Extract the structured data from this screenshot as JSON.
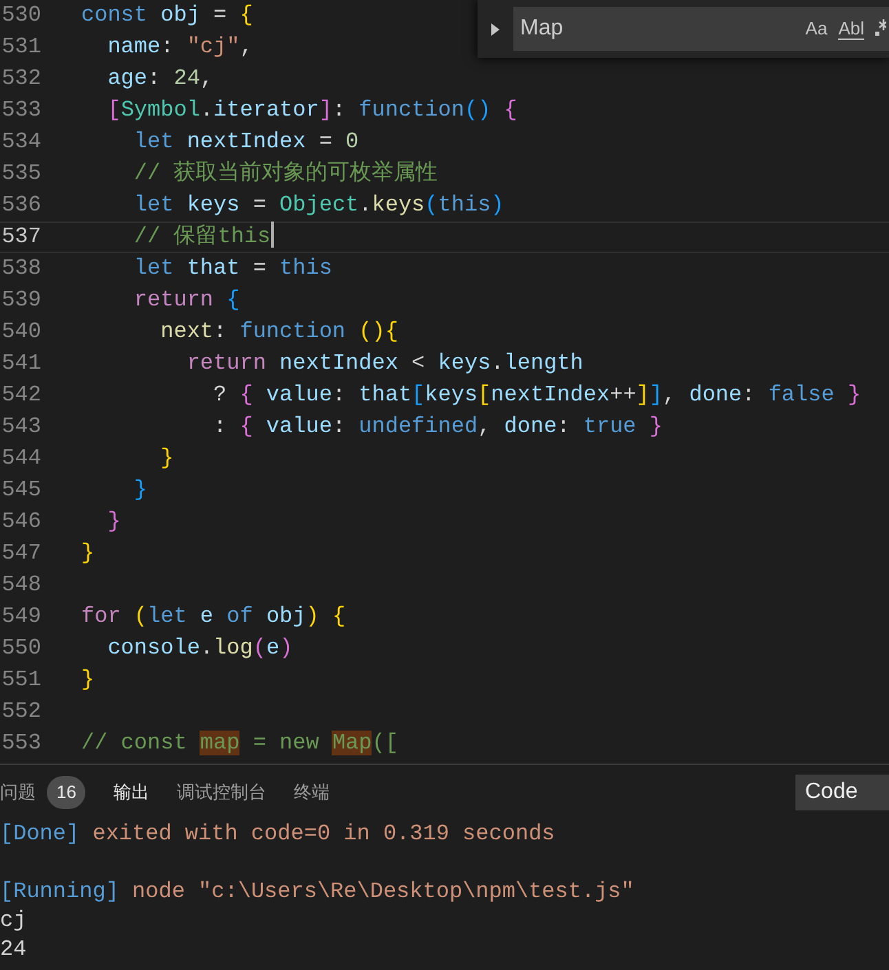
{
  "editor": {
    "lines": [
      {
        "number": "530",
        "current": false,
        "tokens": [
          {
            "kind": "kw",
            "text": "const "
          },
          {
            "kind": "var",
            "text": "obj"
          },
          {
            "kind": "punct",
            "text": " = "
          },
          {
            "kind": "b1",
            "text": "{"
          }
        ]
      },
      {
        "number": "531",
        "current": false,
        "tokens": [
          {
            "kind": "var",
            "text": "  name"
          },
          {
            "kind": "punct",
            "text": ": "
          },
          {
            "kind": "str",
            "text": "\"cj\""
          },
          {
            "kind": "punct",
            "text": ","
          }
        ]
      },
      {
        "number": "532",
        "current": false,
        "tokens": [
          {
            "kind": "var",
            "text": "  age"
          },
          {
            "kind": "punct",
            "text": ": "
          },
          {
            "kind": "num",
            "text": "24"
          },
          {
            "kind": "punct",
            "text": ","
          }
        ]
      },
      {
        "number": "533",
        "current": false,
        "tokens": [
          {
            "kind": "b2",
            "text": "  ["
          },
          {
            "kind": "cls",
            "text": "Symbol"
          },
          {
            "kind": "punct",
            "text": "."
          },
          {
            "kind": "var",
            "text": "iterator"
          },
          {
            "kind": "b2",
            "text": "]"
          },
          {
            "kind": "punct",
            "text": ": "
          },
          {
            "kind": "kw",
            "text": "function"
          },
          {
            "kind": "b3",
            "text": "()"
          },
          {
            "kind": "b2",
            "text": " {"
          }
        ]
      },
      {
        "number": "534",
        "current": false,
        "tokens": [
          {
            "kind": "kw",
            "text": "    let "
          },
          {
            "kind": "var",
            "text": "nextIndex"
          },
          {
            "kind": "punct",
            "text": " = "
          },
          {
            "kind": "num",
            "text": "0"
          }
        ]
      },
      {
        "number": "535",
        "current": false,
        "tokens": [
          {
            "kind": "comment",
            "text": "    // 获取当前对象的可枚举属性"
          }
        ]
      },
      {
        "number": "536",
        "current": false,
        "tokens": [
          {
            "kind": "kw",
            "text": "    let "
          },
          {
            "kind": "var",
            "text": "keys"
          },
          {
            "kind": "punct",
            "text": " = "
          },
          {
            "kind": "cls",
            "text": "Object"
          },
          {
            "kind": "punct",
            "text": "."
          },
          {
            "kind": "fn",
            "text": "keys"
          },
          {
            "kind": "b3",
            "text": "("
          },
          {
            "kind": "kw",
            "text": "this"
          },
          {
            "kind": "b3",
            "text": ")"
          }
        ]
      },
      {
        "number": "537",
        "current": true,
        "tokens": [
          {
            "kind": "comment",
            "text": "    // 保留this"
          }
        ]
      },
      {
        "number": "538",
        "current": false,
        "tokens": [
          {
            "kind": "kw",
            "text": "    let "
          },
          {
            "kind": "var",
            "text": "that"
          },
          {
            "kind": "punct",
            "text": " = "
          },
          {
            "kind": "kw",
            "text": "this"
          }
        ]
      },
      {
        "number": "539",
        "current": false,
        "tokens": [
          {
            "kind": "ctrl",
            "text": "    return "
          },
          {
            "kind": "b3",
            "text": "{"
          }
        ]
      },
      {
        "number": "540",
        "current": false,
        "tokens": [
          {
            "kind": "fn",
            "text": "      next"
          },
          {
            "kind": "punct",
            "text": ": "
          },
          {
            "kind": "kw",
            "text": "function "
          },
          {
            "kind": "b1",
            "text": "(){"
          }
        ]
      },
      {
        "number": "541",
        "current": false,
        "tokens": [
          {
            "kind": "ctrl",
            "text": "        return "
          },
          {
            "kind": "var",
            "text": "nextIndex"
          },
          {
            "kind": "punct",
            "text": " < "
          },
          {
            "kind": "var",
            "text": "keys"
          },
          {
            "kind": "punct",
            "text": "."
          },
          {
            "kind": "var",
            "text": "length"
          }
        ]
      },
      {
        "number": "542",
        "current": false,
        "tokens": [
          {
            "kind": "punct",
            "text": "          ? "
          },
          {
            "kind": "b2",
            "text": "{"
          },
          {
            "kind": "var",
            "text": " value"
          },
          {
            "kind": "punct",
            "text": ": "
          },
          {
            "kind": "var",
            "text": "that"
          },
          {
            "kind": "b3",
            "text": "["
          },
          {
            "kind": "var",
            "text": "keys"
          },
          {
            "kind": "b1",
            "text": "["
          },
          {
            "kind": "var",
            "text": "nextIndex"
          },
          {
            "kind": "punct",
            "text": "++"
          },
          {
            "kind": "b1",
            "text": "]"
          },
          {
            "kind": "b3",
            "text": "]"
          },
          {
            "kind": "punct",
            "text": ", "
          },
          {
            "kind": "var",
            "text": "done"
          },
          {
            "kind": "punct",
            "text": ": "
          },
          {
            "kind": "kw",
            "text": "false"
          },
          {
            "kind": "b2",
            "text": " }"
          }
        ]
      },
      {
        "number": "543",
        "current": false,
        "tokens": [
          {
            "kind": "punct",
            "text": "          : "
          },
          {
            "kind": "b2",
            "text": "{"
          },
          {
            "kind": "var",
            "text": " value"
          },
          {
            "kind": "punct",
            "text": ": "
          },
          {
            "kind": "kw",
            "text": "undefined"
          },
          {
            "kind": "punct",
            "text": ", "
          },
          {
            "kind": "var",
            "text": "done"
          },
          {
            "kind": "punct",
            "text": ": "
          },
          {
            "kind": "kw",
            "text": "true"
          },
          {
            "kind": "b2",
            "text": " }"
          }
        ]
      },
      {
        "number": "544",
        "current": false,
        "tokens": [
          {
            "kind": "b1",
            "text": "      }"
          }
        ]
      },
      {
        "number": "545",
        "current": false,
        "tokens": [
          {
            "kind": "b3",
            "text": "    }"
          }
        ]
      },
      {
        "number": "546",
        "current": false,
        "tokens": [
          {
            "kind": "b2",
            "text": "  }"
          }
        ]
      },
      {
        "number": "547",
        "current": false,
        "tokens": [
          {
            "kind": "b1",
            "text": "}"
          }
        ]
      },
      {
        "number": "548",
        "current": false
      },
      {
        "number": "549",
        "current": false,
        "tokens": [
          {
            "kind": "ctrl",
            "text": "for "
          },
          {
            "kind": "b1",
            "text": "("
          },
          {
            "kind": "kw",
            "text": "let "
          },
          {
            "kind": "var",
            "text": "e"
          },
          {
            "kind": "kw",
            "text": " of "
          },
          {
            "kind": "var",
            "text": "obj"
          },
          {
            "kind": "b1",
            "text": ")"
          },
          {
            "kind": "b1",
            "text": " {"
          }
        ]
      },
      {
        "number": "550",
        "current": false,
        "tokens": [
          {
            "kind": "var",
            "text": "  console"
          },
          {
            "kind": "punct",
            "text": "."
          },
          {
            "kind": "fn",
            "text": "log"
          },
          {
            "kind": "b2",
            "text": "("
          },
          {
            "kind": "var",
            "text": "e"
          },
          {
            "kind": "b2",
            "text": ")"
          }
        ]
      },
      {
        "number": "551",
        "current": false,
        "tokens": [
          {
            "kind": "b1",
            "text": "}"
          }
        ]
      },
      {
        "number": "552",
        "current": false
      },
      {
        "number": "553",
        "current": false,
        "tokens": [
          {
            "kind": "comment",
            "text": "// const "
          },
          {
            "kind": "match",
            "text": "map"
          },
          {
            "kind": "comment",
            "text": " = new "
          },
          {
            "kind": "match",
            "text": "Map"
          },
          {
            "kind": "comment",
            "text": "(["
          }
        ]
      }
    ]
  },
  "find_widget": {
    "expanded": false,
    "query": "Map",
    "match_case": "Aa",
    "whole_word": "Abl"
  },
  "panel": {
    "tabs": [
      {
        "label": "问题",
        "badge": "16",
        "selected": false
      },
      {
        "label": "输出",
        "selected": true
      },
      {
        "label": "调试控制台",
        "selected": false
      },
      {
        "label": "终端",
        "selected": false
      }
    ],
    "channel": "Code",
    "output": [
      {
        "lines": [
          [
            {
              "kind": "tag",
              "text": "[Done]"
            },
            {
              "kind": "path",
              "text": " exited with code=0 in 0.319 seconds"
            }
          ]
        ]
      },
      {
        "lines": [
          [
            {
              "kind": "tag",
              "text": "[Running]"
            },
            {
              "kind": "path",
              "text": " node \"c:\\Users\\Re\\Desktop\\npm\\test.js\""
            }
          ],
          [
            {
              "kind": "plain",
              "text": "cj"
            }
          ],
          [
            {
              "kind": "plain",
              "text": "24"
            }
          ]
        ]
      }
    ]
  }
}
